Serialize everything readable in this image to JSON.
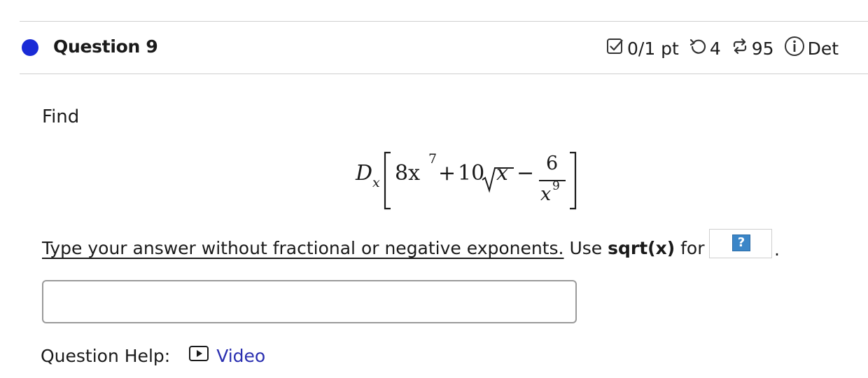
{
  "header": {
    "title": "Question 9",
    "score": "0/1 pt",
    "retries": "4",
    "attempts": "95",
    "details_label": "Det",
    "status_color": "#1a2bd6"
  },
  "body": {
    "prompt": "Find",
    "expression": {
      "operator": "D",
      "operator_subscript": "x",
      "term1": "8x",
      "term1_exp": "7",
      "plus": "+",
      "term2_coef": "10",
      "term2_radicand": "x",
      "minus": "−",
      "frac_num": "6",
      "frac_den": "x",
      "frac_den_exp": "9"
    },
    "instruction_underlined": "Type your answer without fractional or negative exponents.",
    "instruction_use": "Use",
    "instruction_code": "sqrt(x)",
    "instruction_for": "for",
    "help_icon_label": "?",
    "instruction_end": "."
  },
  "answer": {
    "value": "",
    "placeholder": ""
  },
  "help": {
    "label": "Question Help:",
    "video_label": "Video",
    "link_color": "#2a2fb0"
  },
  "icons": {
    "score": "checkbox-icon",
    "retries": "retry-icon",
    "attempts": "attempts-icon",
    "details": "info-icon",
    "video": "play-icon"
  }
}
